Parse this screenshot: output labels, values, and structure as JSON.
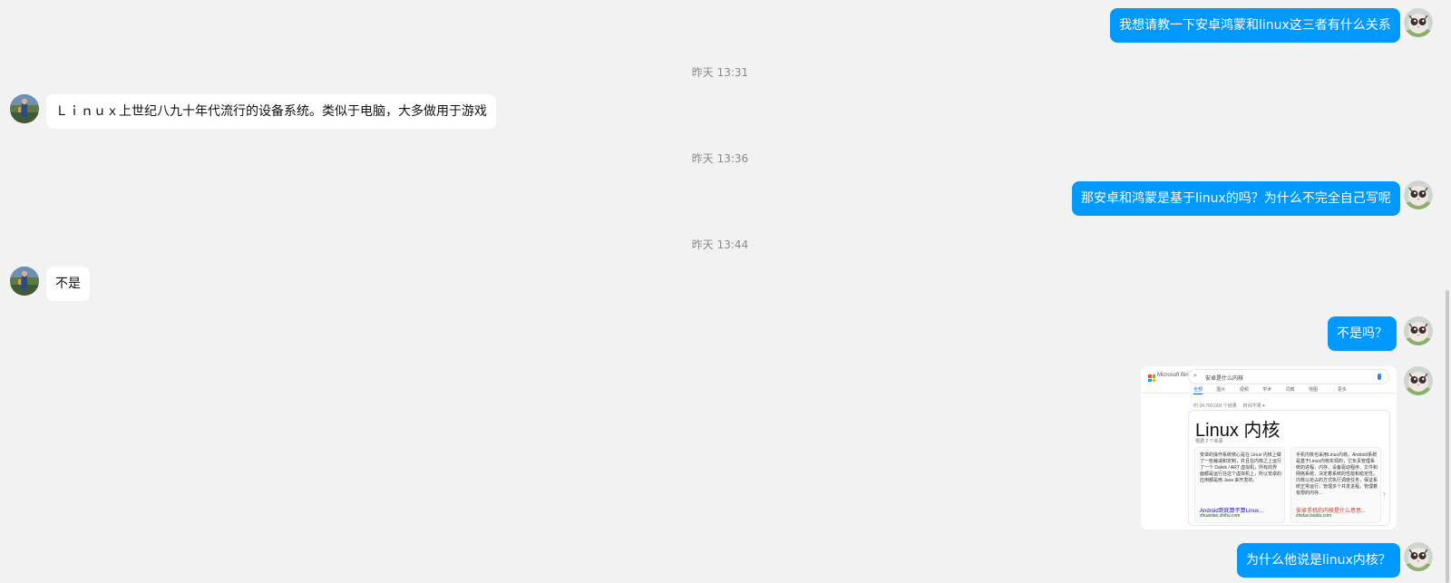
{
  "messages": {
    "m1": {
      "text": "我想请教一下安卓鸿蒙和linux这三者有什么关系"
    },
    "m2": {
      "text": "Ｌｉｎｕｘ上世纪八九十年代流行的设备系统。类似于电脑，大多做用于游戏"
    },
    "m3": {
      "text": "那安卓和鸿蒙是基于linux的吗？为什么不完全自己写呢"
    },
    "m4": {
      "text": "不是"
    },
    "m5": {
      "text": "不是吗？"
    },
    "m6": {
      "text": "为什么他说是linux内核？"
    }
  },
  "timestamps": {
    "t1": "昨天 13:31",
    "t2": "昨天 13:36",
    "t3": "昨天 13:44"
  },
  "screenshot": {
    "brand": "Microsoft Bing",
    "query": "安卓是什么内核",
    "tabs": [
      "全部",
      "图片",
      "视频",
      "学术",
      "词典",
      "地图",
      "⋮ 更多"
    ],
    "result_count": "约 24,700,000 个结果",
    "time_filter": "时间不限 ▾",
    "card_title": "Linux 内核",
    "card_sources": "根据 2 个来源",
    "sources": [
      {
        "text": "安卓的操作系统核心是在 Linux 内核上做了一些裁减和定制，并且在内核之上运行了一个 Dalvik / ART 虚拟机，所有的界面都是运行在这个虚拟机上，所以安卓的应用都是用 Java 来开发的。",
        "link": "Android到底算不算Linux...",
        "url": "zhuanlan.zhihu.com"
      },
      {
        "text": "手机内核也采用Linux内核。Android系统是基于Linux内核实现的，它负责管理系统的进程、内存、设备驱动程序、文件和网络系统，决定着系统的性能和稳定性。内核以抢占的方式执行调度任务，保证系统正常运行，管理多个并发进程，管理着有限的内存...",
        "link": "安卓手机的内核是什么意思...",
        "url": "zhidao.baidu.com"
      }
    ]
  },
  "colors": {
    "outgoing_bubble": "#0099ff",
    "incoming_bubble": "#ffffff",
    "background": "#f2f2f2"
  }
}
